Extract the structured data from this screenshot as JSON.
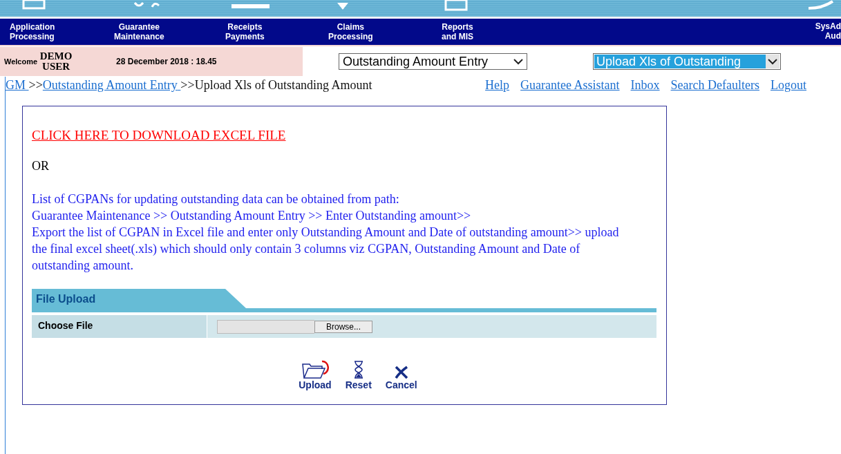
{
  "nav": {
    "items": [
      {
        "lines": [
          "Application",
          "Processing"
        ]
      },
      {
        "lines": [
          "Guarantee",
          "Maintenance"
        ]
      },
      {
        "lines": [
          "Receipts",
          "Payments"
        ]
      },
      {
        "lines": [
          "Claims",
          "Processing"
        ]
      },
      {
        "lines": [
          "Reports",
          "and MIS"
        ]
      }
    ],
    "right_item": {
      "lines": [
        "SysAd",
        "Aud"
      ]
    }
  },
  "user_bar": {
    "welcome": "Welcome",
    "user": "DEMO USER",
    "datetime": "28 December 2018 : 18.45",
    "menu_select": "Outstanding Amount Entry",
    "submenu_select": "Upload Xls of Outstanding"
  },
  "breadcrumb": {
    "links": [
      "GM",
      "Outstanding Amount Entry"
    ],
    "separator": ">>",
    "current": ">>Upload Xls of Outstanding Amount"
  },
  "top_links": [
    "Help",
    "Guarantee Assistant",
    "Inbox",
    "Search Defaulters",
    "Logout"
  ],
  "download_link": "CLICK HERE TO DOWNLOAD EXCEL FILE",
  "or_text": "OR",
  "instructions": [
    "List of CGPANs for updating outstanding data can be obtained from path:",
    "Guarantee Maintenance >> Outstanding Amount Entry >> Enter Outstanding amount>>",
    "Export the list of CGPAN in Excel file and enter only Outstanding Amount and Date of outstanding amount>> upload the final excel sheet(.xls) which should only contain 3 columns viz CGPAN, Outstanding Amount and Date of outstanding amount."
  ],
  "file_upload": {
    "title": "File Upload",
    "label": "Choose File",
    "browse": "Browse..."
  },
  "actions": [
    {
      "kind": "upload",
      "label": "Upload"
    },
    {
      "kind": "reset",
      "label": "Reset"
    },
    {
      "kind": "cancel",
      "label": "Cancel"
    }
  ]
}
